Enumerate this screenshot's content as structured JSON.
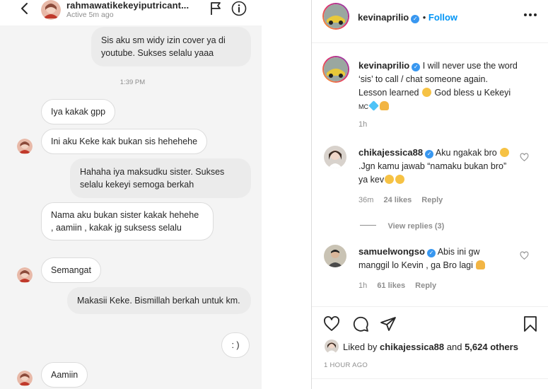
{
  "dm": {
    "username": "rahmawatikekeyiputricant...",
    "status": "Active 5m ago",
    "messages": {
      "m1": "Sis aku sm widy izin cover ya di youtube. Sukses selalu yaaa",
      "time": "1:39 PM",
      "m2": "Iya kakak gpp",
      "m3": "Ini aku Keke kak bukan sis hehehehe",
      "m4": "Hahaha iya maksudku sister. Sukses selalu kekeyi semoga berkah",
      "m5": "Nama aku  bukan sister kakak hehehe , aamiin , kakak jg suksess selalu",
      "m6": "Semangat",
      "m7": "Makasii Keke. Bismillah berkah untuk km.",
      "m8": ": )",
      "m9": "Aamiin"
    }
  },
  "post": {
    "username": "kevinaprilio",
    "follow_label": "Follow",
    "caption": {
      "username": "kevinaprilio",
      "text1": "I will never use the word ‘sis’ to call / chat someone again. Lesson learned",
      "text2": "God bless u Kekeyi",
      "mc": "MC",
      "time": "1h"
    },
    "comments": [
      {
        "username": "chikajessica88",
        "text_a": "Aku ngakak bro",
        "text_b": ".Jgn kamu jawab “namaku bukan bro” ya kev",
        "time": "36m",
        "likes": "24 likes",
        "reply": "Reply"
      },
      {
        "username": "samuelwongso",
        "text_a": "Abis ini gw manggil lo Kevin , ga Bro lagi",
        "time": "1h",
        "likes": "61 likes",
        "reply": "Reply"
      }
    ],
    "view_replies": "View replies (3)",
    "liked_by_prefix": "Liked by",
    "liked_by_user": "chikajessica88",
    "liked_by_and": "and",
    "liked_by_others": "5,624 others",
    "posted_time": "1 HOUR AGO",
    "more_icon": "more-horizontal-icon"
  },
  "colors": {
    "accent": "#0095f6",
    "verified": "#3897f0",
    "bubble_out": "#ebebeb",
    "dm_bg": "#f4f4f4"
  }
}
